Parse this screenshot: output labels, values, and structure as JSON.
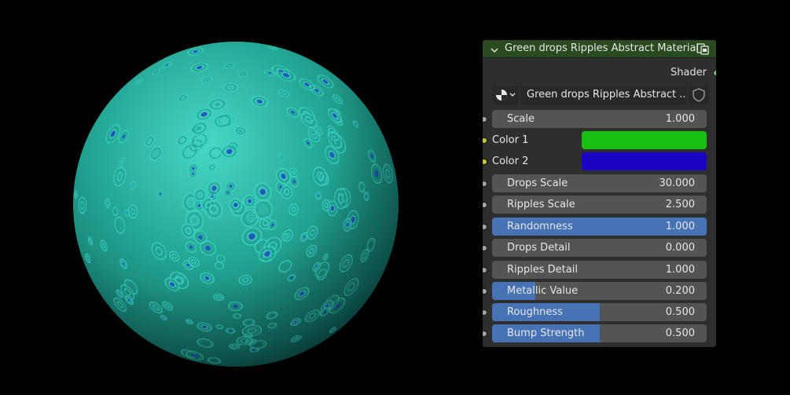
{
  "node": {
    "title": "Green drops Ripples Abstract Material",
    "output_label": "Shader",
    "material_name": "Green drops Ripples Abstract ...",
    "header_color": "#2a4a20"
  },
  "inputs": {
    "scale": {
      "label": "Scale",
      "value": "1.000"
    },
    "color1": {
      "label": "Color 1",
      "color": "#18bf10"
    },
    "color2": {
      "label": "Color 2",
      "color": "#1a05c2"
    },
    "drops_scale": {
      "label": "Drops Scale",
      "value": "30.000"
    },
    "ripples_scale": {
      "label": "Ripples Scale",
      "value": "2.500"
    },
    "randomness": {
      "label": "Randomness",
      "value": "1.000",
      "fraction": 1.0
    },
    "drops_detail": {
      "label": "Drops Detail",
      "value": "0.000"
    },
    "ripples_detail": {
      "label": "Ripples Detail",
      "value": "1.000"
    },
    "metallic_value": {
      "label": "Metallic Value",
      "value": "0.200",
      "fraction": 0.2
    },
    "roughness": {
      "label": "Roughness",
      "value": "0.500",
      "fraction": 0.5
    },
    "bump_strength": {
      "label": "Bump Strength",
      "value": "0.500",
      "fraction": 0.5
    }
  },
  "preview": {
    "base_color": "#1e9f92",
    "highlight_color": "#3ed1bf",
    "accent_color": "#2643c8"
  },
  "icons": {
    "collapse": "chevron-down-icon",
    "header": "node-preview-icon",
    "material_browse": "material-sphere-icon",
    "fake_user": "shield-icon"
  }
}
